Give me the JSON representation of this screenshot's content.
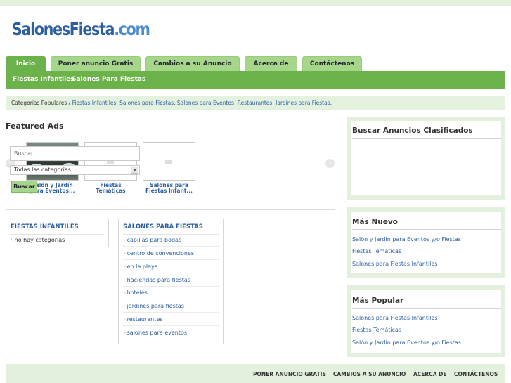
{
  "logo": {
    "part1": "Salones",
    "part2": "Fiesta",
    "part3": ".com"
  },
  "tabs": [
    {
      "label": "Inicio"
    },
    {
      "label": "Poner anuncio Gratis"
    },
    {
      "label": "Cambios a su Anuncio"
    },
    {
      "label": "Acerca de"
    },
    {
      "label": "Contáctenos"
    }
  ],
  "subnav": [
    {
      "label": "Fiestas Infantiles"
    },
    {
      "label": "Salones Para Fiestas"
    }
  ],
  "categories_bar": {
    "prefix": "Categorías Populares / ",
    "links": [
      "Fiestas Infantiles",
      "Salones para Fiestas",
      "Salones para Eventos",
      "Restaurantes",
      "Jardines para Fiestas"
    ],
    "separator": ","
  },
  "featured": {
    "title": "Featured Ads",
    "prev_icon": "‹",
    "next_icon": "›",
    "ads": [
      {
        "line1": "Salón y Jardín",
        "line2": "para Eventos..."
      },
      {
        "line1": "Fiestas Temáticas",
        "line2": ""
      },
      {
        "line1": "Salones para",
        "line2": "Fiestas Infant..."
      }
    ]
  },
  "fiestas_infantiles": {
    "heading": "FIESTAS INFANTILES",
    "items": [
      "no hay categorías"
    ]
  },
  "salones_para_fiestas": {
    "heading": "SALONES PARA FIESTAS",
    "items": [
      "capillas para bodas",
      "centro de convenciones",
      "en la playa",
      "haciendas para fiestas",
      "hoteles",
      "jardines para fiestas",
      "restaurantes",
      "salones para eventos"
    ]
  },
  "search_box": {
    "title": "Buscar Anuncios Clasificados",
    "placeholder": "Buscar...",
    "category_selected": "Todas las categorías",
    "button": "Buscar"
  },
  "mas_nuevo": {
    "title": "Más Nuevo",
    "links": [
      "Salón y Jardín para Eventos y/o Fiestas",
      "Fiestas Temáticas",
      "Salones para Fiestas Infantiles"
    ]
  },
  "mas_popular": {
    "title": "Más Popular",
    "links": [
      "Salones para Fiestas Infantiles",
      "Fiestas Temáticas",
      "Salón y Jardín para Eventos y/o Fiestas"
    ]
  },
  "footer": {
    "links": [
      "PONER ANUNCIO GRATIS",
      "CAMBIOS A SU ANUNCIO",
      "ACERCA DE",
      "CONTÁCTENOS"
    ]
  },
  "colors": {
    "accent_green": "#6cb24a",
    "tab_green": "#a6d68a",
    "panel_green": "#e3f0dd",
    "link_blue": "#2a5fa0",
    "logo_dark_blue": "#2c5f9e",
    "logo_light_blue": "#4a8bd0"
  }
}
